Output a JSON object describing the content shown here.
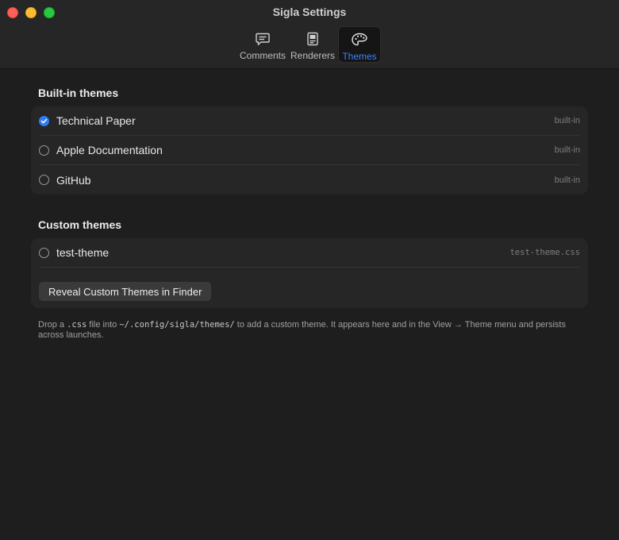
{
  "window": {
    "title": "Sigla Settings"
  },
  "tabs": [
    {
      "id": "comments",
      "label": "Comments",
      "icon": "comment-icon",
      "active": false
    },
    {
      "id": "renderers",
      "label": "Renderers",
      "icon": "renderer-icon",
      "active": false
    },
    {
      "id": "themes",
      "label": "Themes",
      "icon": "palette-icon",
      "active": true
    }
  ],
  "builtin": {
    "title": "Built-in themes",
    "items": [
      {
        "label": "Technical Paper",
        "tag": "built-in",
        "selected": true
      },
      {
        "label": "Apple Documentation",
        "tag": "built-in",
        "selected": false
      },
      {
        "label": "GitHub",
        "tag": "built-in",
        "selected": false
      }
    ]
  },
  "custom": {
    "title": "Custom themes",
    "items": [
      {
        "label": "test-theme",
        "tag": "test-theme.css",
        "selected": false
      }
    ],
    "reveal_button": "Reveal Custom Themes in Finder"
  },
  "help": {
    "part1": "Drop a ",
    "code1": ".css",
    "part2": " file into ",
    "code2": "~/.config/sigla/themes/",
    "part3": " to add a custom theme. It appears here and in the View → Theme menu and persists across launches."
  },
  "colors": {
    "accent": "#2f7cf6",
    "background": "#1e1e1e",
    "group": "#262626"
  }
}
